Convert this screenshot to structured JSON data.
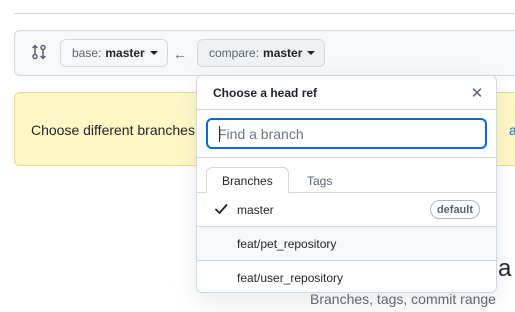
{
  "range_bar": {
    "base_prefix": "base:",
    "base_value": "master",
    "compare_prefix": "compare:",
    "compare_value": "master",
    "arrow": "←"
  },
  "flash": {
    "message": "Choose different branches",
    "link_fragment": "arn"
  },
  "blank_state": {
    "title_fragment": "e a",
    "subtitle": "Branches, tags, commit range"
  },
  "popover": {
    "title": "Choose a head ref",
    "close_glyph": "✕",
    "filter_placeholder": "Find a branch",
    "filter_value": "",
    "tabs": [
      {
        "label": "Branches",
        "active": true
      },
      {
        "label": "Tags",
        "active": false
      }
    ],
    "items": [
      {
        "name": "master",
        "selected": true,
        "badge": "default"
      },
      {
        "name": "feat/pet_repository",
        "selected": false
      },
      {
        "name": "feat/user_repository",
        "selected": false
      }
    ]
  },
  "colors": {
    "accent": "#0969da",
    "flash_bg": "#fff8c5",
    "border": "#d1d9e0",
    "muted": "#59636e"
  },
  "icons": {
    "compare": "git-compare-icon",
    "check": "check-icon",
    "close": "close-icon",
    "caret": "triangle-down-icon"
  }
}
